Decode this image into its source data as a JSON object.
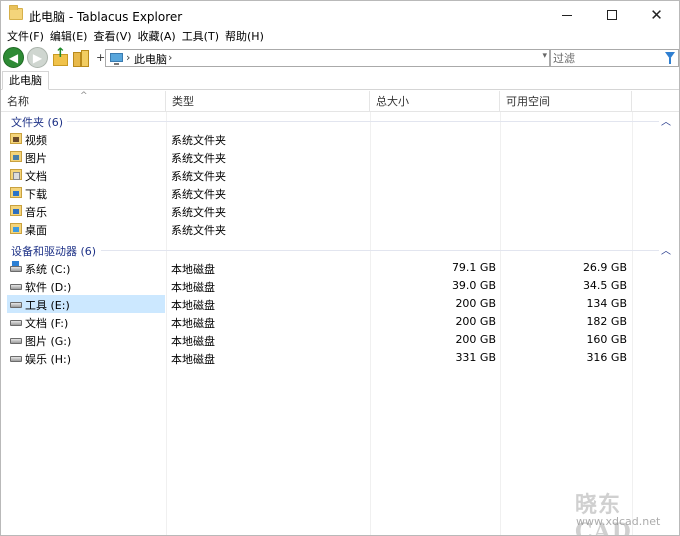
{
  "window": {
    "title": "此电脑 - Tablacus Explorer",
    "buttons": {
      "minimize": "—",
      "maximize": "☐",
      "close": "✕"
    }
  },
  "menu": [
    "文件(F)",
    "编辑(E)",
    "查看(V)",
    "收藏(A)",
    "工具(T)",
    "帮助(H)"
  ],
  "toolbar": {
    "back": "◀",
    "forward": "▶",
    "plus": "+",
    "address": {
      "separator": "›",
      "path": "此电脑",
      "trailing": "›",
      "dropdown": "▾"
    },
    "filter_placeholder": "过滤"
  },
  "tab": {
    "label": "此电脑"
  },
  "columns": {
    "name": "名称",
    "type": "类型",
    "total": "总大小",
    "free": "可用空间",
    "sort_indicator": "^"
  },
  "groups": [
    {
      "label": "文件夹 (6)",
      "chevron": "︿"
    },
    {
      "label": "设备和驱动器 (6)",
      "chevron": "︿"
    }
  ],
  "folders": [
    {
      "name": "视频",
      "type": "系统文件夹",
      "icon": "videos-folder-icon"
    },
    {
      "name": "图片",
      "type": "系统文件夹",
      "icon": "pictures-folder-icon"
    },
    {
      "name": "文档",
      "type": "系统文件夹",
      "icon": "documents-folder-icon"
    },
    {
      "name": "下载",
      "type": "系统文件夹",
      "icon": "downloads-folder-icon"
    },
    {
      "name": "音乐",
      "type": "系统文件夹",
      "icon": "music-folder-icon"
    },
    {
      "name": "桌面",
      "type": "系统文件夹",
      "icon": "desktop-folder-icon"
    }
  ],
  "drives": [
    {
      "name": "系统 (C:)",
      "type": "本地磁盘",
      "total": "79.1 GB",
      "free": "26.9 GB",
      "icon": "system-drive-icon"
    },
    {
      "name": "软件 (D:)",
      "type": "本地磁盘",
      "total": "39.0 GB",
      "free": "34.5 GB",
      "icon": "drive-icon"
    },
    {
      "name": "工具 (E:)",
      "type": "本地磁盘",
      "total": "200 GB",
      "free": "134 GB",
      "icon": "drive-icon",
      "selected": true
    },
    {
      "name": "文档 (F:)",
      "type": "本地磁盘",
      "total": "200 GB",
      "free": "182 GB",
      "icon": "drive-icon"
    },
    {
      "name": "图片 (G:)",
      "type": "本地磁盘",
      "total": "200 GB",
      "free": "160 GB",
      "icon": "drive-icon"
    },
    {
      "name": "娱乐 (H:)",
      "type": "本地磁盘",
      "total": "331 GB",
      "free": "316 GB",
      "icon": "drive-icon"
    }
  ],
  "watermark": {
    "brand": "晓东 CAD",
    "url": "www.xdcad.net"
  }
}
